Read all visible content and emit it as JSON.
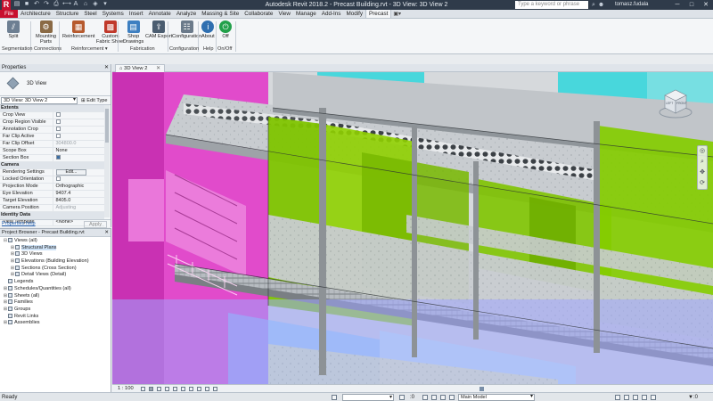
{
  "titlebar": {
    "title": "Autodesk Revit 2018.2 - Precast Building.rvt - 3D View: 3D View 2",
    "search_placeholder": "Type a keyword or phrase",
    "user": "tomasz.fudala",
    "app_letter": "R"
  },
  "ribbon_tabs": [
    "File",
    "Architecture",
    "Structure",
    "Steel",
    "Systems",
    "Insert",
    "Annotate",
    "Analyze",
    "Massing & Site",
    "Collaborate",
    "View",
    "Manage",
    "Add-Ins",
    "Modify",
    "Precast"
  ],
  "active_tab": "Precast",
  "ribbon": {
    "buttons": {
      "split": "Split",
      "mounting_parts": "Mounting\nParts",
      "reinforcement": "Reinforcement",
      "custom_fabric_sheet": "Custom\nFabric Sheet",
      "shop_drawings": "Shop\nDrawings",
      "cam_export": "CAM Export",
      "configuration": "Configuration",
      "about": "About",
      "off": "Off"
    },
    "groups": {
      "segmentation": "Segmentation",
      "connections": "Connections",
      "reinforcement": "Reinforcement ▾",
      "fabrication": "Fabrication",
      "configuration": "Configuration",
      "help": "Help",
      "on_off": "On/Off"
    }
  },
  "properties": {
    "title": "Properties",
    "type_name": "3D View",
    "instance_selector": "3D View: 3D View 2",
    "edit_type": "Edit Type",
    "rows": [
      {
        "label": "Extents",
        "category": true
      },
      {
        "label": "Crop View",
        "checkbox": false
      },
      {
        "label": "Crop Region Visible",
        "checkbox": false
      },
      {
        "label": "Annotation Crop",
        "checkbox": false
      },
      {
        "label": "Far Clip Active",
        "checkbox": false
      },
      {
        "label": "Far Clip Offset",
        "value": "304800.0",
        "readonly": true
      },
      {
        "label": "Scope Box",
        "value": "None"
      },
      {
        "label": "Section Box",
        "checkbox": true
      },
      {
        "label": "Camera",
        "category": true
      },
      {
        "label": "Rendering Settings",
        "button": "Edit..."
      },
      {
        "label": "Locked Orientation",
        "checkbox": false,
        "readonly": true
      },
      {
        "label": "Projection Mode",
        "value": "Orthographic"
      },
      {
        "label": "Eye Elevation",
        "value": "9407.4"
      },
      {
        "label": "Target Elevation",
        "value": "8405.0"
      },
      {
        "label": "Camera Position",
        "value": "Adjusting",
        "readonly": true
      },
      {
        "label": "Identity Data",
        "category": true
      },
      {
        "label": "View Template",
        "value": "<None>"
      }
    ],
    "help_link": "Properties help",
    "apply": "Apply"
  },
  "project_browser": {
    "title": "Project Browser - Precast Building.rvt",
    "nodes": [
      {
        "level": 0,
        "toggle": "⊟",
        "label": "Views (all)"
      },
      {
        "level": 1,
        "toggle": "⊞",
        "label": "Structural Plans",
        "selected": true
      },
      {
        "level": 1,
        "toggle": "⊞",
        "label": "3D Views"
      },
      {
        "level": 1,
        "toggle": "⊞",
        "label": "Elevations (Building Elevation)"
      },
      {
        "level": 1,
        "toggle": "⊞",
        "label": "Sections (Cross Section)"
      },
      {
        "level": 1,
        "toggle": "⊞",
        "label": "Detail Views (Detail)"
      },
      {
        "level": 0,
        "toggle": "",
        "label": "Legends"
      },
      {
        "level": 0,
        "toggle": "⊞",
        "label": "Schedules/Quantities (all)"
      },
      {
        "level": 0,
        "toggle": "⊞",
        "label": "Sheets (all)"
      },
      {
        "level": 0,
        "toggle": "⊞",
        "label": "Families"
      },
      {
        "level": 0,
        "toggle": "⊞",
        "label": "Groups"
      },
      {
        "level": 0,
        "toggle": "",
        "label": "Revit Links"
      },
      {
        "level": 0,
        "toggle": "⊞",
        "label": "Assemblies"
      }
    ]
  },
  "view_tab": {
    "label": "3D View 2"
  },
  "viewcube": {
    "left": "LEFT",
    "front": "FRONT"
  },
  "view_control": {
    "scale": "1 : 100"
  },
  "status": {
    "ready": "Ready",
    "selection_count": ":0",
    "model": "Main Model",
    "filter_icon": "▼:0"
  },
  "colors": {
    "magenta": "#e23fc9",
    "cyan": "#2fd6dc",
    "lime": "#7fc400",
    "slab": "#c9cdd0",
    "revit_red": "#c8102e",
    "titlebar": "#2f3b4a"
  }
}
